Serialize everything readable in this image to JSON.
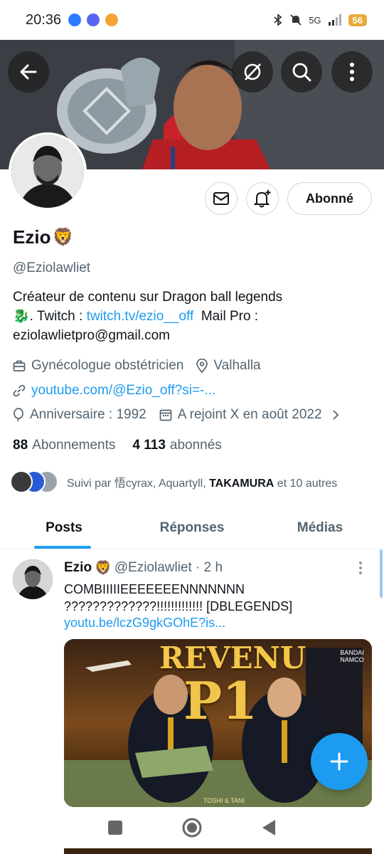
{
  "status_bar": {
    "time": "20:36",
    "network": "5G",
    "battery": "56",
    "app_icons": [
      "messenger-icon",
      "discord-icon",
      "orange-app-icon"
    ],
    "right_icons": [
      "bluetooth-icon",
      "mute-icon",
      "signal-icon"
    ]
  },
  "header": {
    "back_icon": "arrow-left-icon",
    "grok_icon": "grok-icon",
    "search_icon": "search-icon",
    "more_icon": "more-vertical-icon"
  },
  "profile": {
    "name": "Ezio",
    "name_emoji": "🦁",
    "handle": "@Eziolawliet",
    "bio_line1": "Créateur de contenu sur Dragon ball legends",
    "bio_emoji": "🐉",
    "bio_twitch_prefix": ". Twitch : ",
    "bio_twitch_link": "twitch.tv/ezio__off",
    "bio_mail_label": "Mail Pro :",
    "bio_email": "eziolawlietpro@gmail.com",
    "job": "Gynécologue obstétricien",
    "location": "Valhalla",
    "website": "youtube.com/@Ezio_off?si=-...",
    "birthday": "Anniversaire : 1992",
    "joined": "A rejoint X en août 2022",
    "following_count": "88",
    "following_label": "Abonnements",
    "followers_count": "4 113",
    "followers_label": "abonnés",
    "followed_by_prefix": "Suivi par ",
    "followed_by_names": "悟cyrax, Aquartyll, ",
    "followed_by_bold": "TAKAMURA",
    "followed_by_suffix": " et 10 autres",
    "follow_button": "Abonné",
    "message_icon": "mail-icon",
    "notify_icon": "bell-plus-icon"
  },
  "tabs": [
    {
      "label": "Posts",
      "active": true
    },
    {
      "label": "Réponses",
      "active": false
    },
    {
      "label": "Médias",
      "active": false
    }
  ],
  "post": {
    "author": "Ezio",
    "author_emoji": "🦁",
    "handle_time": "@Eziolawliet · 2 h",
    "text": "COMBIIIIIEEEEEEENNNNNNN ?????????????!!!!!!!!!!!!! [DBLEGENDS]",
    "link": "youtu.be/lczG9gkGOhE?is...",
    "media_text_top": "REVENU",
    "media_text_big": "P1",
    "media_brand": "BANDAI NAMCO",
    "media_caption": "TOSHI & TANI"
  },
  "fab": {
    "icon": "plus-icon"
  },
  "nav_bar": [
    "recents-square-icon",
    "home-circle-icon",
    "back-triangle-icon"
  ],
  "colors": {
    "accent": "#1d9bf0",
    "text": "#0f1419",
    "secondary": "#536471",
    "border": "#cfd9de"
  }
}
